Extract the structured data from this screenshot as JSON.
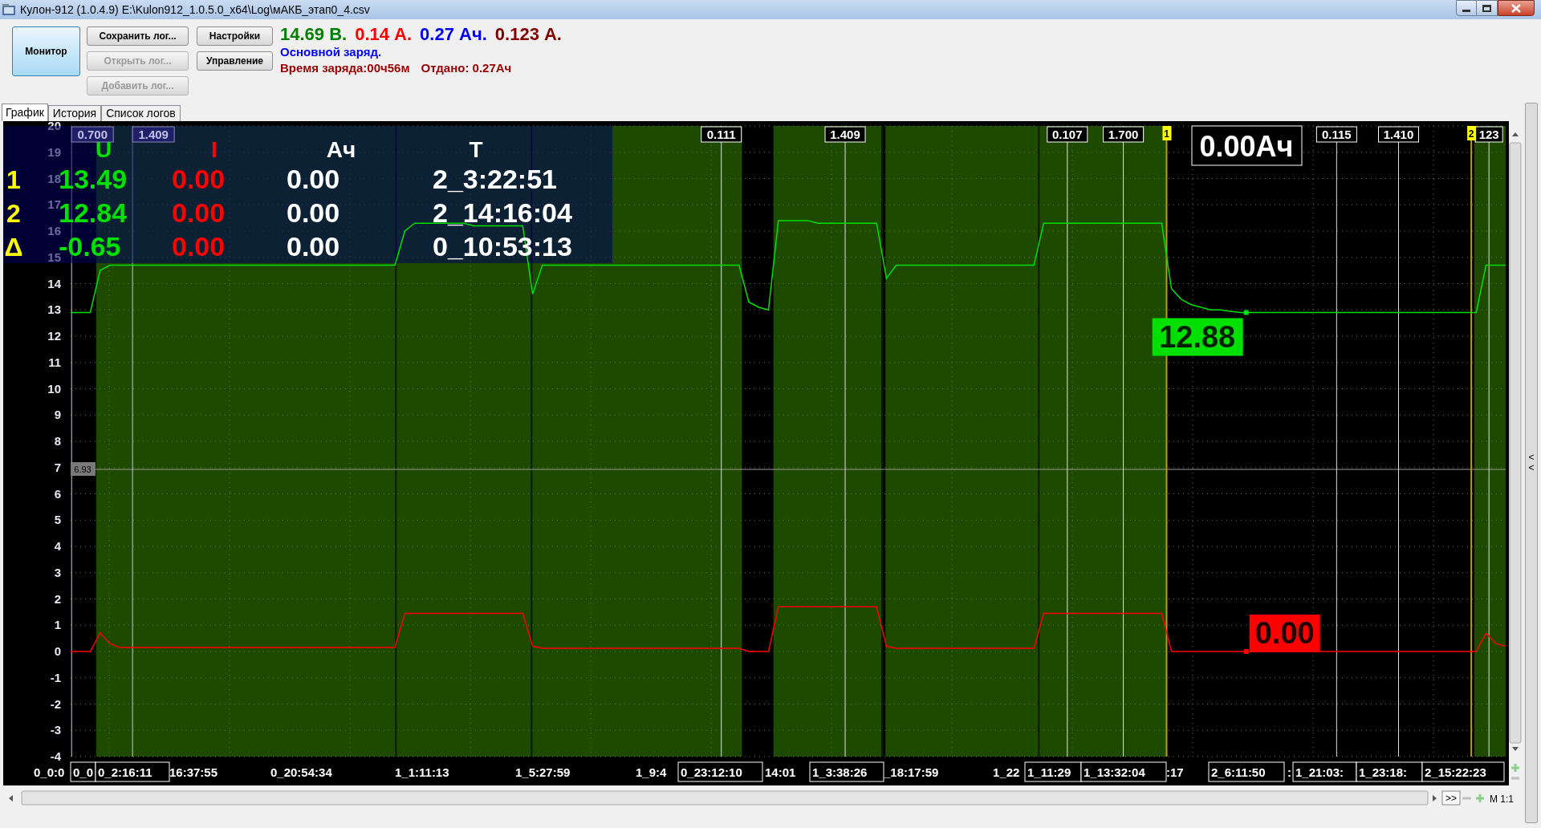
{
  "window": {
    "title": "Кулон-912 (1.0.4.9) E:\\Kulon912_1.0.5.0_x64\\Log\\мАКБ_этап0_4.csv"
  },
  "toolbar": {
    "buttons": [
      {
        "label": "Монитор",
        "kind": "mode",
        "disabled": false
      },
      {
        "label": "Сохранить лог...",
        "kind": "action",
        "disabled": false
      },
      {
        "label": "Открыть лог...",
        "kind": "action",
        "disabled": true
      },
      {
        "label": "Добавить лог...",
        "kind": "action",
        "disabled": true
      },
      {
        "label": "Настройки",
        "kind": "action",
        "disabled": false
      },
      {
        "label": "Управление",
        "kind": "action",
        "disabled": false
      }
    ]
  },
  "readings": [
    {
      "text": "14.69 В.",
      "color": "#008000"
    },
    {
      "text": "0.14 А.",
      "color": "#ff0000"
    },
    {
      "text": "0.27 Ач.",
      "color": "#0000ff"
    },
    {
      "text": "0.123 А.",
      "color": "#800000"
    }
  ],
  "status": {
    "mode": "Основной заряд.",
    "details": [
      "Время заряда:00ч56м",
      "Отдано: 0.27Ач"
    ]
  },
  "tabs": [
    {
      "label": "График",
      "selected": true
    },
    {
      "label": "История",
      "selected": false
    },
    {
      "label": "Список логов",
      "selected": false
    }
  ],
  "readout_table": {
    "columns": [
      "Ач",
      "T"
    ],
    "rows": [
      {
        "label": "1",
        "values": [
          "13.49",
          "0.00",
          "0.00",
          "2_3:22:51"
        ]
      },
      {
        "label": "2",
        "values": [
          "12.84",
          "0.00",
          "0.00",
          "2_14:16:04"
        ]
      },
      {
        "label": "Δ",
        "values": [
          "-0.65",
          "0.00",
          "0.00",
          "0_10:53:13"
        ]
      }
    ]
  },
  "chart_data": {
    "type": "line",
    "ylim": [
      -4,
      20
    ],
    "grid": true,
    "ref_lines": [
      {
        "axis": "y",
        "value": 6.93,
        "label": "6.93"
      }
    ],
    "yticks": [
      -4,
      -3,
      -2,
      -1,
      0,
      1,
      2,
      3,
      4,
      5,
      6,
      7,
      8,
      9,
      10,
      11,
      12,
      13,
      14,
      15,
      16,
      17,
      18,
      19,
      20
    ],
    "categories": [
      null,
      null,
      null,
      null,
      null,
      null,
      null,
      null,
      null,
      null,
      null,
      null,
      null,
      null,
      null,
      null,
      null,
      null,
      null,
      null,
      null,
      null,
      null,
      null,
      null,
      null,
      null,
      null,
      null,
      null,
      null,
      null,
      null,
      null,
      null,
      null,
      null,
      null,
      null,
      null,
      null,
      null,
      null,
      null,
      null,
      null,
      null,
      null,
      null,
      null,
      null,
      null,
      null,
      null,
      null,
      null,
      null,
      null,
      null,
      null,
      null,
      null,
      null,
      null,
      null,
      null,
      null,
      null,
      null,
      null,
      null,
      null,
      null,
      null,
      null,
      null,
      null,
      null,
      null,
      null,
      null,
      null,
      null,
      null,
      null,
      null,
      null,
      null,
      null,
      null,
      null,
      null,
      null,
      null,
      null,
      null,
      null,
      null,
      null,
      null,
      null,
      null,
      null,
      null,
      null,
      null,
      null,
      null,
      null,
      null,
      null,
      null,
      null,
      null,
      null,
      null,
      null,
      null,
      null,
      null,
      null,
      null,
      null,
      null,
      null,
      null,
      null,
      null,
      null,
      null,
      null,
      null,
      null,
      null,
      null,
      null,
      null,
      null,
      null,
      null,
      null,
      null,
      null,
      null,
      null,
      null,
      null
    ],
    "series": [
      {
        "name": "U",
        "color": "#00e000",
        "values": [
          12.9,
          12.9,
          12.9,
          14.5,
          14.7,
          14.7,
          14.7,
          14.7,
          14.7,
          14.7,
          14.7,
          14.7,
          14.7,
          14.7,
          14.7,
          14.7,
          14.7,
          14.7,
          14.7,
          14.7,
          14.7,
          14.7,
          14.7,
          14.7,
          14.7,
          14.7,
          14.7,
          14.7,
          14.7,
          14.7,
          14.7,
          14.7,
          14.7,
          14.7,
          16.0,
          16.3,
          16.3,
          16.3,
          16.3,
          16.3,
          16.3,
          16.2,
          16.2,
          16.2,
          16.2,
          16.2,
          16.2,
          13.6,
          14.7,
          14.7,
          14.7,
          14.7,
          14.7,
          14.7,
          14.7,
          14.7,
          14.7,
          14.7,
          14.7,
          14.7,
          14.7,
          14.7,
          14.7,
          14.7,
          14.7,
          14.7,
          14.7,
          14.7,
          14.7,
          13.3,
          13.1,
          13.0,
          16.4,
          16.4,
          16.4,
          16.4,
          16.3,
          16.3,
          16.3,
          16.3,
          16.3,
          16.3,
          16.3,
          14.2,
          14.7,
          14.7,
          14.7,
          14.7,
          14.7,
          14.7,
          14.7,
          14.7,
          14.7,
          14.7,
          14.7,
          14.7,
          14.7,
          14.7,
          14.7,
          16.3,
          16.3,
          16.3,
          16.3,
          16.3,
          16.3,
          16.3,
          16.3,
          16.3,
          16.3,
          16.3,
          16.3,
          16.3,
          13.8,
          13.4,
          13.2,
          13.1,
          13.0,
          13.0,
          12.95,
          12.9,
          12.9,
          12.9,
          12.9,
          12.9,
          12.9,
          12.9,
          12.9,
          12.9,
          12.9,
          12.9,
          12.9,
          12.9,
          12.9,
          12.9,
          12.9,
          12.9,
          12.9,
          12.9,
          12.9,
          12.9,
          12.9,
          12.9,
          12.9,
          12.9,
          14.7,
          14.7,
          14.7
        ]
      },
      {
        "name": "I",
        "color": "#ff0000",
        "values": [
          0.0,
          0.0,
          0.0,
          0.7,
          0.3,
          0.15,
          0.15,
          0.15,
          0.15,
          0.15,
          0.15,
          0.15,
          0.15,
          0.15,
          0.15,
          0.15,
          0.15,
          0.15,
          0.15,
          0.15,
          0.15,
          0.15,
          0.15,
          0.15,
          0.15,
          0.15,
          0.15,
          0.15,
          0.15,
          0.15,
          0.15,
          0.15,
          0.15,
          0.15,
          1.45,
          1.45,
          1.45,
          1.45,
          1.45,
          1.45,
          1.45,
          1.45,
          1.45,
          1.45,
          1.45,
          1.45,
          1.45,
          0.2,
          0.12,
          0.12,
          0.12,
          0.12,
          0.12,
          0.12,
          0.12,
          0.12,
          0.12,
          0.12,
          0.12,
          0.12,
          0.12,
          0.12,
          0.12,
          0.12,
          0.12,
          0.12,
          0.12,
          0.12,
          0.12,
          0.0,
          0.0,
          0.0,
          1.7,
          1.7,
          1.7,
          1.7,
          1.7,
          1.7,
          1.7,
          1.7,
          1.7,
          1.7,
          1.7,
          0.2,
          0.12,
          0.12,
          0.12,
          0.12,
          0.12,
          0.12,
          0.12,
          0.12,
          0.12,
          0.12,
          0.12,
          0.12,
          0.12,
          0.12,
          0.12,
          1.45,
          1.45,
          1.45,
          1.45,
          1.45,
          1.45,
          1.45,
          1.45,
          1.45,
          1.45,
          1.45,
          1.45,
          1.45,
          0.0,
          0.0,
          0.0,
          0.0,
          0.0,
          0.0,
          0.0,
          0.0,
          0.0,
          0.0,
          0.0,
          0.0,
          0.0,
          0.0,
          0.0,
          0.0,
          0.0,
          0.0,
          0.0,
          0.0,
          0.0,
          0.0,
          0.0,
          0.0,
          0.0,
          0.0,
          0.0,
          0.0,
          0.0,
          0.0,
          0.0,
          0.0,
          0.7,
          0.3,
          0.2
        ]
      }
    ]
  },
  "chart_overlays": {
    "cursor_labels": [
      "0.700",
      "1.409",
      "0.111",
      "1.409",
      "0.107",
      "1.700",
      "0.115",
      "1.410",
      "123"
    ],
    "markers": [
      "1",
      "2"
    ],
    "total": "0.00Ач",
    "point_readouts": [
      "12.88",
      "0.00"
    ]
  },
  "x_axis_labels": [
    {
      "text": "0_0:0",
      "boxed": false
    },
    {
      "text": "0_0",
      "boxed": true
    },
    {
      "text": "0_2:16:11",
      "boxed": true
    },
    {
      "text": "16:37:55",
      "boxed": false
    },
    {
      "text": "0_20:54:34",
      "boxed": false
    },
    {
      "text": "1_1:11:13",
      "boxed": false
    },
    {
      "text": "1_5:27:59",
      "boxed": false
    },
    {
      "text": "1_9:4",
      "boxed": false
    },
    {
      "text": "0_23:12:10",
      "boxed": true
    },
    {
      "text": "14:01",
      "boxed": false
    },
    {
      "text": "1_3:38:26",
      "boxed": true
    },
    {
      "text": "_18:17:59",
      "boxed": false
    },
    {
      "text": "1_22",
      "boxed": false
    },
    {
      "text": "1_11:29",
      "boxed": true
    },
    {
      "text": "1_13:32:04",
      "boxed": true
    },
    {
      "text": ":17",
      "boxed": false
    },
    {
      "text": "2_6:11:50",
      "boxed": true
    },
    {
      "text": ":",
      "boxed": false
    },
    {
      "text": "1_21:03:",
      "boxed": true
    },
    {
      "text": "1_23:18:",
      "boxed": true
    },
    {
      "text": "2_15:22:23",
      "boxed": true
    }
  ],
  "scroll_controls": {
    "fast_forward": ">>",
    "zoom": "M 1:1",
    "side_toggle": "<<"
  }
}
